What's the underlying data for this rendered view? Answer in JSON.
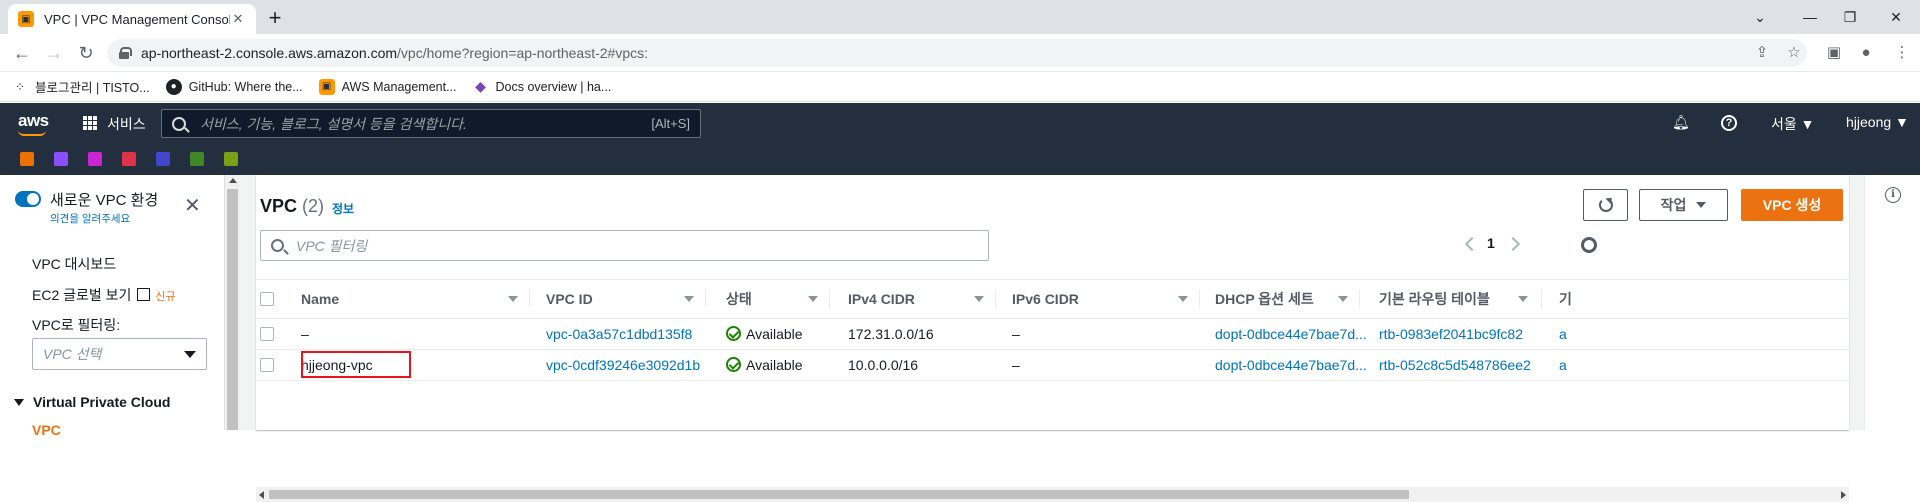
{
  "browser": {
    "tab_title": "VPC | VPC Management Console",
    "tab_favicon": "aws-box-icon",
    "url_host": "ap-northeast-2.console.aws.amazon.com",
    "url_path": "/vpc/home?region=ap-northeast-2#vpcs:",
    "bookmarks": [
      {
        "icon": "grid-dots-icon",
        "label": "블로그관리 | TISTO..."
      },
      {
        "icon": "github-icon",
        "label": "GitHub: Where the..."
      },
      {
        "icon": "aws-box-icon",
        "label": "AWS Management..."
      },
      {
        "icon": "terraform-icon",
        "label": "Docs overview | ha..."
      }
    ]
  },
  "aws_header": {
    "logo": "aws",
    "services_label": "서비스",
    "search_placeholder": "서비스, 기능, 블로그, 설명서 등을 검색합니다.",
    "search_shortcut": "[Alt+S]",
    "region": "서울 ▼",
    "user": "hjjeong ▼"
  },
  "sidebar": {
    "toggle_title": "새로운 VPC 환경",
    "toggle_sub": "의견을 알려주세요",
    "dashboard": "VPC 대시보드",
    "ec2_global": "EC2 글로벌 보기",
    "new_badge": "신규",
    "filter_label": "VPC로 필터링:",
    "filter_placeholder": "VPC 선택",
    "section": "Virtual Private Cloud",
    "active_item": "VPC"
  },
  "panel": {
    "title": "VPC",
    "count": "(2)",
    "info": "정보",
    "actions_label": "작업",
    "create_label": "VPC 생성",
    "filter_placeholder": "VPC 필터링",
    "page": "1"
  },
  "table": {
    "columns": [
      "Name",
      "VPC ID",
      "상태",
      "IPv4 CIDR",
      "IPv6 CIDR",
      "DHCP 옵션 세트",
      "기본 라우팅 테이블",
      "기"
    ],
    "rows": [
      {
        "name": "–",
        "vpc_id": "vpc-0a3a57c1dbd135f8",
        "state": "Available",
        "ipv4": "172.31.0.0/16",
        "ipv6": "–",
        "dhcp": "dopt-0dbce44e7bae7d...",
        "rtb": "rtb-0983ef2041bc9fc82",
        "extra": "a"
      },
      {
        "name": "hjjeong-vpc",
        "vpc_id": "vpc-0cdf39246e3092d1b",
        "state": "Available",
        "ipv4": "10.0.0.0/16",
        "ipv6": "–",
        "dhcp": "dopt-0dbce44e7bae7d...",
        "rtb": "rtb-052c8c5d548786ee2",
        "extra": "a"
      }
    ]
  },
  "colors": {
    "aws_nav": "#232f3e",
    "accent": "#ec7211",
    "link": "#0073bb",
    "success": "#1d8102",
    "highlight": "#e5141f"
  }
}
